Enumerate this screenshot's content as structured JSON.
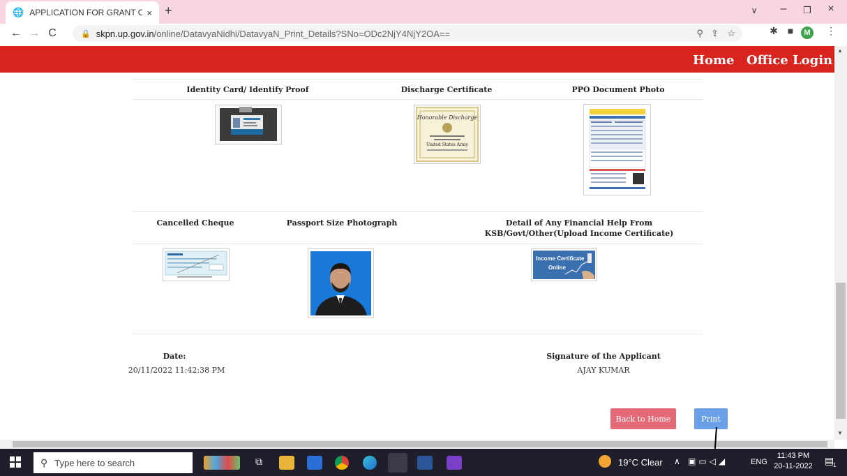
{
  "browser": {
    "tab_title": "APPLICATION FOR GRANT OF FI",
    "tab_close": "×",
    "new_tab": "+",
    "url_host": "skpn.up.gov.in",
    "url_path": "/online/DatavyaNidhi/DatavyaN_Print_Details?SNo=ODc2NjY4NjY2OA==",
    "profile_initial": "M"
  },
  "header": {
    "home": "Home",
    "office_login": "Office Login"
  },
  "documents_row1": [
    {
      "label": "Identity Card/ Identify Proof",
      "icon": "id-card-image"
    },
    {
      "label": "Discharge Certificate",
      "icon": "certificate-image"
    },
    {
      "label": "PPO Document Photo",
      "icon": "document-image"
    }
  ],
  "documents_row2": [
    {
      "label": "Cancelled Cheque",
      "icon": "cheque-image"
    },
    {
      "label": "Passport Size Photograph",
      "icon": "photo-image"
    },
    {
      "label_line1": "Detail of Any Financial Help From",
      "label_line2": "KSB/Govt/Other(Upload Income Certificate)",
      "icon": "income-certificate-image"
    }
  ],
  "income_cert_text1": "Income Certificate",
  "income_cert_text2": "Online",
  "footer": {
    "date_label": "Date:",
    "date_value": "20/11/2022 11:42:38 PM",
    "signature_label": "Signature of the Applicant",
    "signature_value": "AJAY KUMAR"
  },
  "buttons": {
    "back": "Back to Home",
    "print": "Print"
  },
  "colors": {
    "header_red": "#d9231d",
    "back_btn": "#e56a78",
    "print_btn": "#6aa0e8"
  },
  "taskbar": {
    "search_placeholder": "Type here to search",
    "weather": "19°C  Clear",
    "lang": "ENG",
    "time": "11:43 PM",
    "date": "20-11-2022",
    "notification_count": "1"
  }
}
